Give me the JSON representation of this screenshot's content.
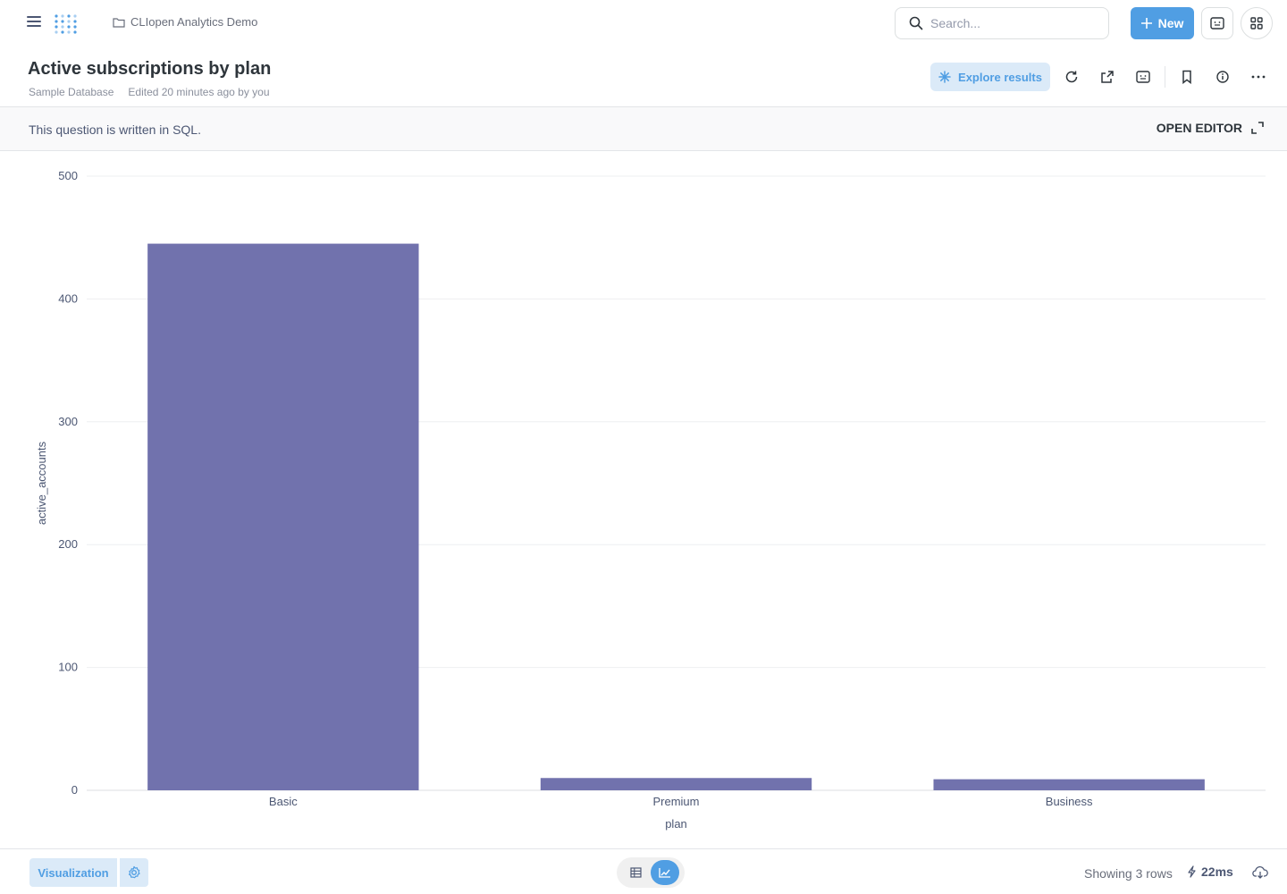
{
  "topbar": {
    "collection_name": "CLIopen Analytics Demo",
    "search_placeholder": "Search...",
    "new_label": "New"
  },
  "header": {
    "title": "Active subscriptions by plan",
    "database": "Sample Database",
    "edited": "Edited 20 minutes ago by you",
    "explore_label": "Explore results"
  },
  "notice": {
    "text": "This question is written in SQL.",
    "open_editor_label": "OPEN EDITOR"
  },
  "footer": {
    "visualization_label": "Visualization",
    "rows_text": "Showing 3 rows",
    "timing": "22ms"
  },
  "colors": {
    "accent": "#509ee3",
    "bar": "#7172ad"
  },
  "chart_data": {
    "type": "bar",
    "categories": [
      "Basic",
      "Premium",
      "Business"
    ],
    "values": [
      445,
      10,
      9
    ],
    "xlabel": "plan",
    "ylabel": "active_accounts",
    "ylim": [
      0,
      500
    ],
    "yticks": [
      0,
      100,
      200,
      300,
      400,
      500
    ],
    "grid": true
  }
}
